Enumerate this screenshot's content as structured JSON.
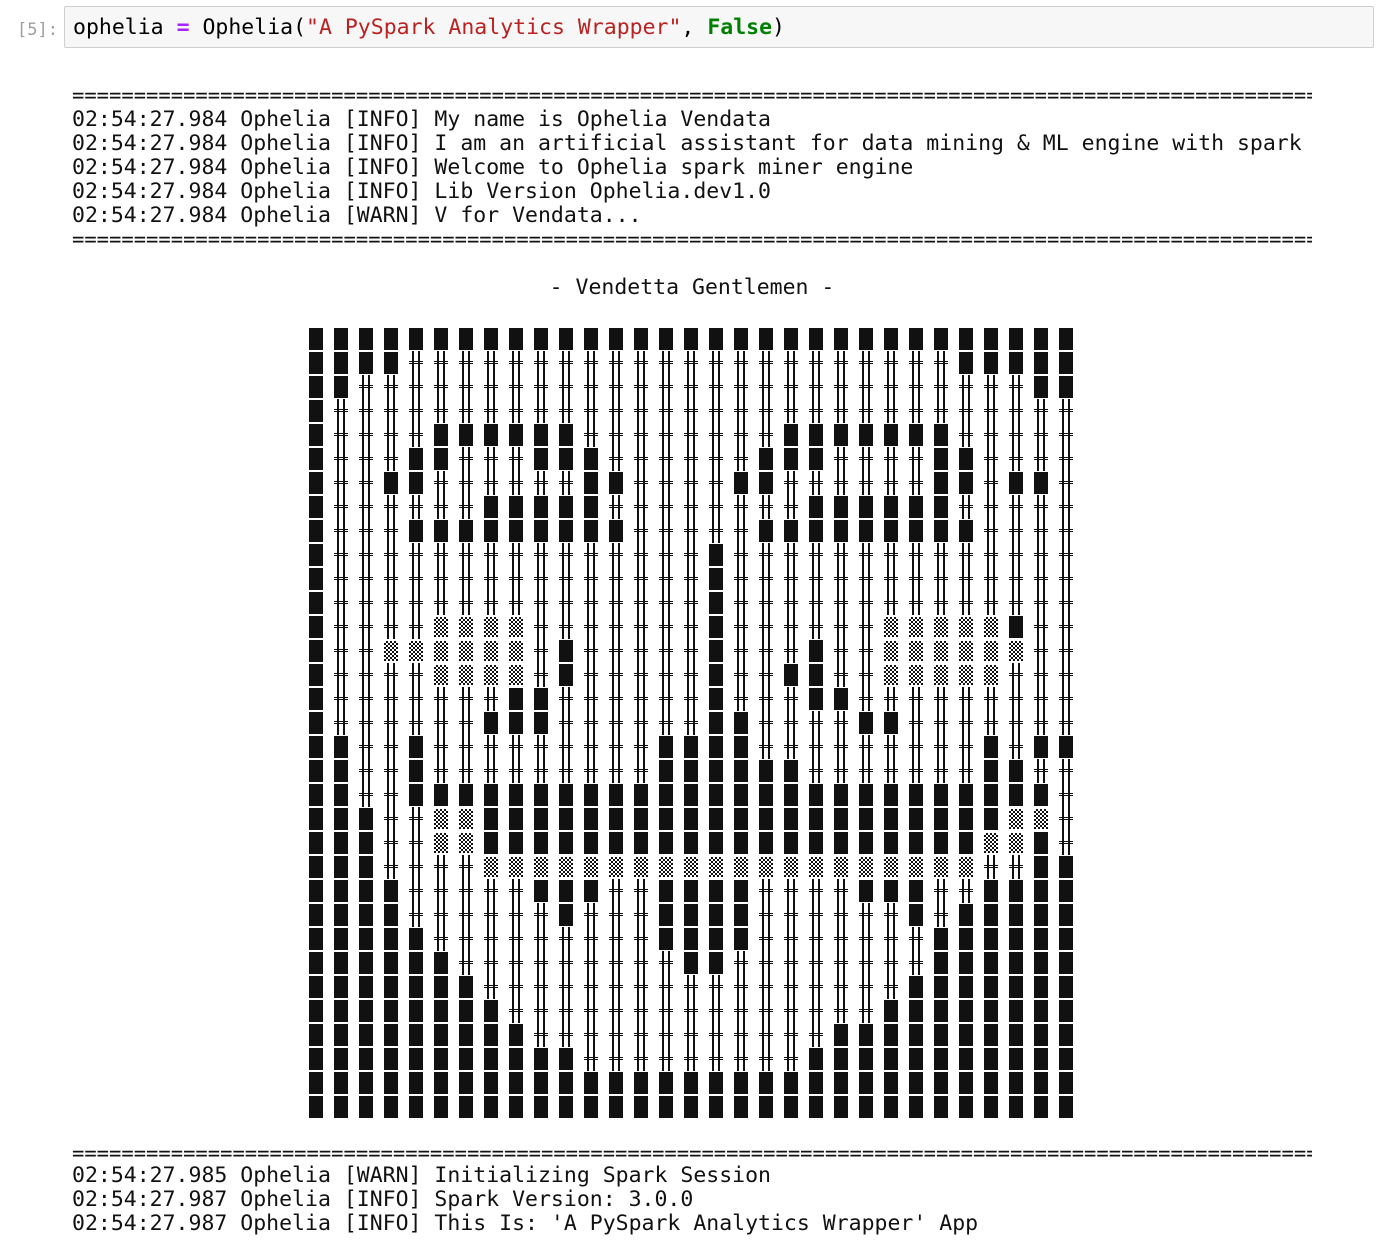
{
  "cell": {
    "prompt": "[5]:",
    "code": {
      "var": "ophelia",
      "op": "=",
      "func": "Ophelia(",
      "arg_string": "\"A PySpark Analytics Wrapper\"",
      "sep": ", ",
      "arg_bool": "False",
      "close": ")"
    }
  },
  "output": {
    "separator": "========================================================================================================",
    "log_top": [
      "02:54:27.984 Ophelia [INFO] My name is Ophelia Vendata",
      "02:54:27.984 Ophelia [INFO] I am an artificial assistant for data mining & ML engine with spark",
      "02:54:27.984 Ophelia [INFO] Welcome to Ophelia spark miner engine",
      "02:54:27.984 Ophelia [INFO] Lib Version Ophelia.dev1.0",
      "02:54:27.984 Ophelia [WARN] V for Vendata..."
    ],
    "banner": "- Vendetta Gentlemen -",
    "ascii_art": {
      "legend": {
        "B": "full-block",
        "|": "double-rail",
        "S": "shade-block",
        " ": "blank"
      },
      "rows": [
        "BBBBBBBBBBBBBBBBBBBBBBBBBBBBBBB",
        "BBBB||||||||||||||||||||||BBBBB",
        "BB|||||||||||||||||||||||||||BB",
        "B||||||||||||||||||||||||||||||B",
        "B||||BBBBBB||||||||BBBBBBB|||||B",
        "B|||BB|||BBB||||||BBB||||BB||||B",
        "B||BB||||||BB||||BB||||||BB|BB|B",
        "B||||||BBBBB||||||||BBBBBB|||||B",
        "B|||BBBBBBBBB|||||BBBBBBBBB||||B",
        "B|||||||||||||||B||||||||||||||B",
        "B|||||||||||||||B||||||||||||||B",
        "B|||||||||||||||B||||||||||||||B",
        "B||||SSSS|||||||B||||||SSSSSB||B",
        "B||SSSSSS|B|||||B|||B||SSSSSS||B",
        "B||||SSSS|B|||||B||BB||SSSSS|||B",
        "B|||||||BB||||||B|||BB|||||||||B",
        "B||||||BBB||||||BB||||BB|||||||B",
        "BB||B|||||||||BBBB|||||||||B|BBB",
        "BB||B|||||||||BBBBBB|||||||BB||BB",
        "BB||BBBBBBBBBBBBBBBBBBBBBBBBBB|BB",
        "BBB||SSBBBBBBBBBBBBBBBBBBBBBSS|BB",
        "BBB||SSBBBBBBBBBBBBBBBBBBBBSSB|BB",
        "BBB||||SSSSSSSSSSSSSSSSSSSS||BBB",
        "BBBB|||||BBB||BBBB||||BBB||BBBBB",
        "BBBB||||||B|||BBBB||||||B|BBBBBB",
        "BBBBB|||||||||BBBB|||||||BBBBBBB",
        "BBBBBB|||||||||BB||||||||BBBBBBB",
        "BBBBBBB|||||||||||||||||BBBBBBBB",
        "BBBBBBBB|||||||||||||||BBBBBBBBB",
        "BBBBBBBBB||||||||||||BBBBBBBBBBB",
        "BBBBBBBBBBB|||||||||BBBBBBBBBBBB",
        "BBBBBBBBBBBBBBBBBBBBBBBBBBBBBBB",
        "BBBBBBBBBBBBBBBBBBBBBBBBBBBBBBB"
      ]
    },
    "log_bottom": [
      "02:54:27.985 Ophelia [WARN] Initializing Spark Session",
      "02:54:27.987 Ophelia [INFO] Spark Version: 3.0.0",
      "02:54:27.987 Ophelia [INFO] This Is: 'A PySpark Analytics Wrapper' App"
    ]
  }
}
